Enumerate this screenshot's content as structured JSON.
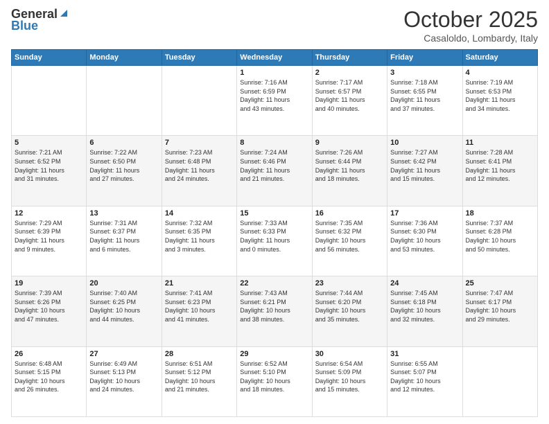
{
  "header": {
    "logo_general": "General",
    "logo_blue": "Blue",
    "month_title": "October 2025",
    "location": "Casaloldo, Lombardy, Italy"
  },
  "days_of_week": [
    "Sunday",
    "Monday",
    "Tuesday",
    "Wednesday",
    "Thursday",
    "Friday",
    "Saturday"
  ],
  "weeks": [
    [
      {
        "day": "",
        "info": ""
      },
      {
        "day": "",
        "info": ""
      },
      {
        "day": "",
        "info": ""
      },
      {
        "day": "1",
        "info": "Sunrise: 7:16 AM\nSunset: 6:59 PM\nDaylight: 11 hours\nand 43 minutes."
      },
      {
        "day": "2",
        "info": "Sunrise: 7:17 AM\nSunset: 6:57 PM\nDaylight: 11 hours\nand 40 minutes."
      },
      {
        "day": "3",
        "info": "Sunrise: 7:18 AM\nSunset: 6:55 PM\nDaylight: 11 hours\nand 37 minutes."
      },
      {
        "day": "4",
        "info": "Sunrise: 7:19 AM\nSunset: 6:53 PM\nDaylight: 11 hours\nand 34 minutes."
      }
    ],
    [
      {
        "day": "5",
        "info": "Sunrise: 7:21 AM\nSunset: 6:52 PM\nDaylight: 11 hours\nand 31 minutes."
      },
      {
        "day": "6",
        "info": "Sunrise: 7:22 AM\nSunset: 6:50 PM\nDaylight: 11 hours\nand 27 minutes."
      },
      {
        "day": "7",
        "info": "Sunrise: 7:23 AM\nSunset: 6:48 PM\nDaylight: 11 hours\nand 24 minutes."
      },
      {
        "day": "8",
        "info": "Sunrise: 7:24 AM\nSunset: 6:46 PM\nDaylight: 11 hours\nand 21 minutes."
      },
      {
        "day": "9",
        "info": "Sunrise: 7:26 AM\nSunset: 6:44 PM\nDaylight: 11 hours\nand 18 minutes."
      },
      {
        "day": "10",
        "info": "Sunrise: 7:27 AM\nSunset: 6:42 PM\nDaylight: 11 hours\nand 15 minutes."
      },
      {
        "day": "11",
        "info": "Sunrise: 7:28 AM\nSunset: 6:41 PM\nDaylight: 11 hours\nand 12 minutes."
      }
    ],
    [
      {
        "day": "12",
        "info": "Sunrise: 7:29 AM\nSunset: 6:39 PM\nDaylight: 11 hours\nand 9 minutes."
      },
      {
        "day": "13",
        "info": "Sunrise: 7:31 AM\nSunset: 6:37 PM\nDaylight: 11 hours\nand 6 minutes."
      },
      {
        "day": "14",
        "info": "Sunrise: 7:32 AM\nSunset: 6:35 PM\nDaylight: 11 hours\nand 3 minutes."
      },
      {
        "day": "15",
        "info": "Sunrise: 7:33 AM\nSunset: 6:33 PM\nDaylight: 11 hours\nand 0 minutes."
      },
      {
        "day": "16",
        "info": "Sunrise: 7:35 AM\nSunset: 6:32 PM\nDaylight: 10 hours\nand 56 minutes."
      },
      {
        "day": "17",
        "info": "Sunrise: 7:36 AM\nSunset: 6:30 PM\nDaylight: 10 hours\nand 53 minutes."
      },
      {
        "day": "18",
        "info": "Sunrise: 7:37 AM\nSunset: 6:28 PM\nDaylight: 10 hours\nand 50 minutes."
      }
    ],
    [
      {
        "day": "19",
        "info": "Sunrise: 7:39 AM\nSunset: 6:26 PM\nDaylight: 10 hours\nand 47 minutes."
      },
      {
        "day": "20",
        "info": "Sunrise: 7:40 AM\nSunset: 6:25 PM\nDaylight: 10 hours\nand 44 minutes."
      },
      {
        "day": "21",
        "info": "Sunrise: 7:41 AM\nSunset: 6:23 PM\nDaylight: 10 hours\nand 41 minutes."
      },
      {
        "day": "22",
        "info": "Sunrise: 7:43 AM\nSunset: 6:21 PM\nDaylight: 10 hours\nand 38 minutes."
      },
      {
        "day": "23",
        "info": "Sunrise: 7:44 AM\nSunset: 6:20 PM\nDaylight: 10 hours\nand 35 minutes."
      },
      {
        "day": "24",
        "info": "Sunrise: 7:45 AM\nSunset: 6:18 PM\nDaylight: 10 hours\nand 32 minutes."
      },
      {
        "day": "25",
        "info": "Sunrise: 7:47 AM\nSunset: 6:17 PM\nDaylight: 10 hours\nand 29 minutes."
      }
    ],
    [
      {
        "day": "26",
        "info": "Sunrise: 6:48 AM\nSunset: 5:15 PM\nDaylight: 10 hours\nand 26 minutes."
      },
      {
        "day": "27",
        "info": "Sunrise: 6:49 AM\nSunset: 5:13 PM\nDaylight: 10 hours\nand 24 minutes."
      },
      {
        "day": "28",
        "info": "Sunrise: 6:51 AM\nSunset: 5:12 PM\nDaylight: 10 hours\nand 21 minutes."
      },
      {
        "day": "29",
        "info": "Sunrise: 6:52 AM\nSunset: 5:10 PM\nDaylight: 10 hours\nand 18 minutes."
      },
      {
        "day": "30",
        "info": "Sunrise: 6:54 AM\nSunset: 5:09 PM\nDaylight: 10 hours\nand 15 minutes."
      },
      {
        "day": "31",
        "info": "Sunrise: 6:55 AM\nSunset: 5:07 PM\nDaylight: 10 hours\nand 12 minutes."
      },
      {
        "day": "",
        "info": ""
      }
    ]
  ]
}
